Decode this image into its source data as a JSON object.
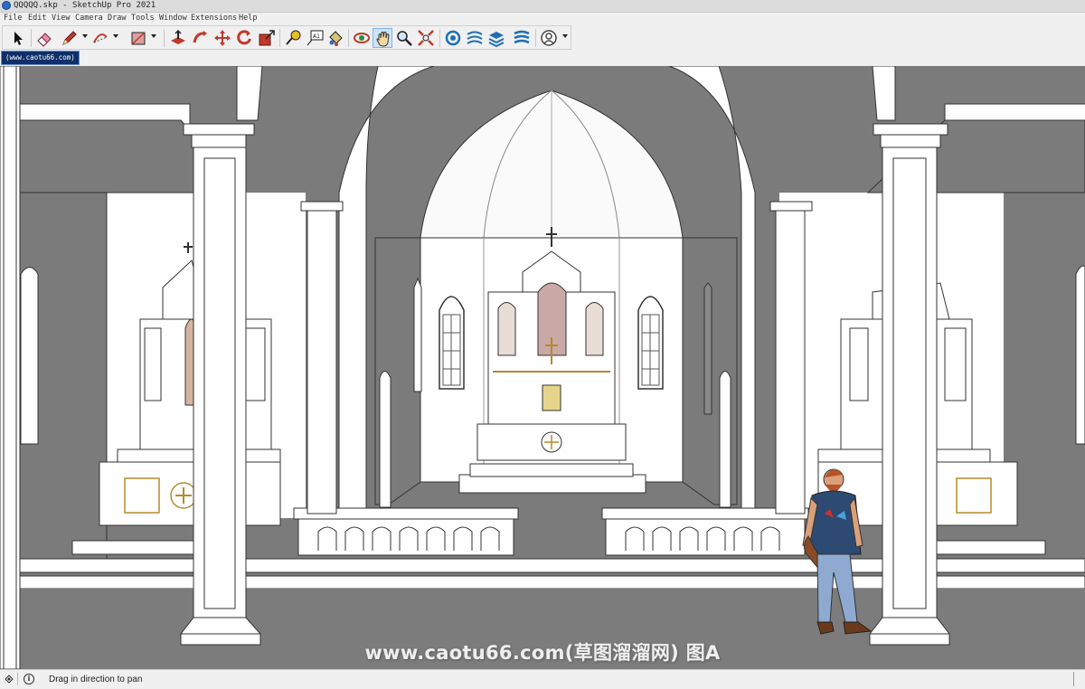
{
  "window": {
    "title": "QQQQQ.skp - SketchUp Pro 2021"
  },
  "menu": [
    "File",
    "Edit",
    "View",
    "Camera",
    "Draw",
    "Tools",
    "Window",
    "Extensions",
    "Help"
  ],
  "toolbar": {
    "buttons": [
      {
        "name": "select-tool",
        "icon": "arrow-cursor-icon"
      },
      {
        "name": "eraser-tool",
        "icon": "eraser-icon"
      },
      {
        "name": "line-tool",
        "icon": "pencil-icon"
      },
      {
        "name": "arc-tool",
        "icon": "arc-icon"
      },
      {
        "name": "shape-tool",
        "icon": "rectangle-icon"
      },
      {
        "name": "push-pull-tool",
        "icon": "push-pull-icon"
      },
      {
        "name": "follow-me-tool",
        "icon": "follow-me-icon"
      },
      {
        "name": "move-tool",
        "icon": "move-icon"
      },
      {
        "name": "rotate-tool",
        "icon": "rotate-icon"
      },
      {
        "name": "scale-tool",
        "icon": "scale-icon"
      },
      {
        "name": "tape-measure-tool",
        "icon": "tape-measure-icon"
      },
      {
        "name": "text-tool",
        "icon": "text-icon"
      },
      {
        "name": "paint-bucket-tool",
        "icon": "paint-bucket-icon"
      },
      {
        "name": "orbit-tool",
        "icon": "orbit-icon"
      },
      {
        "name": "pan-tool",
        "icon": "hand-icon",
        "active": true
      },
      {
        "name": "zoom-tool",
        "icon": "magnifier-icon"
      },
      {
        "name": "zoom-extents-tool",
        "icon": "zoom-extents-icon"
      },
      {
        "name": "warehouse-button",
        "icon": "3d-warehouse-icon"
      },
      {
        "name": "extension-warehouse-button",
        "icon": "extension-warehouse-icon"
      },
      {
        "name": "layout-button",
        "icon": "layers-icon"
      },
      {
        "name": "extension-manager-button",
        "icon": "extension-manager-icon"
      },
      {
        "name": "account-button",
        "icon": "user-account-icon"
      }
    ]
  },
  "scene_tab": {
    "label": "(www.caotu66.com)"
  },
  "viewport": {
    "watermark": "www.caotu66.com(草图溜溜网) 图A"
  },
  "status": {
    "text": "Drag in direction to pan",
    "info_icon": "i"
  },
  "colors": {
    "accent": "#0f2f6a",
    "active_tool": "#cde3f7",
    "floor": "#7c7c7c"
  }
}
